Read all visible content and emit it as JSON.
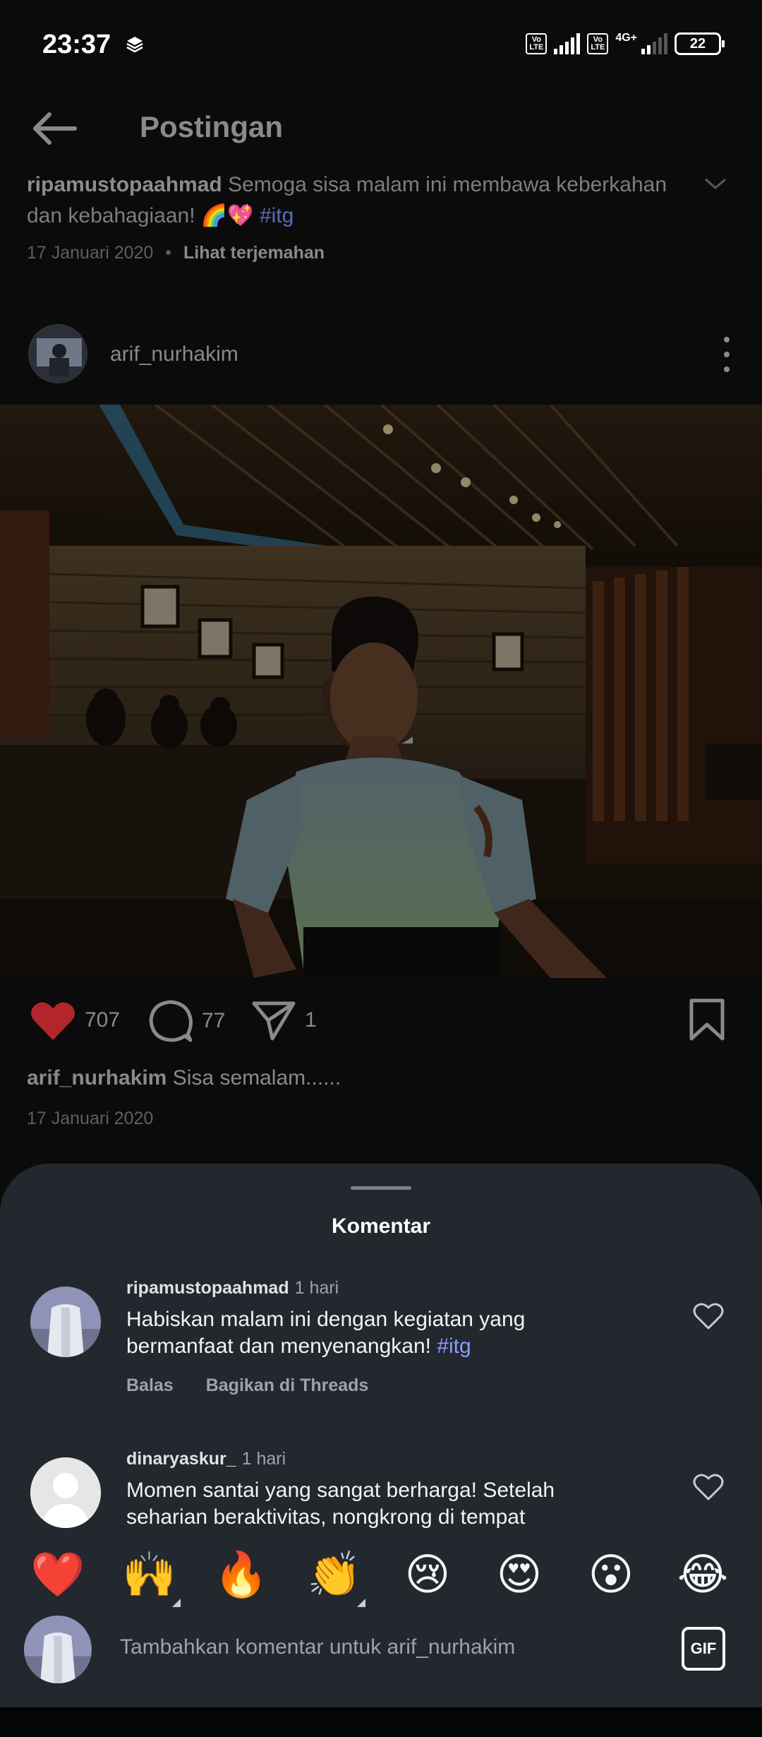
{
  "status": {
    "time": "23:37",
    "battery": "22",
    "network": "4G+",
    "volte": "Vo LTE"
  },
  "header": {
    "title": "Postingan"
  },
  "previous_post": {
    "username": "ripamustopaahmad",
    "caption": "Semoga sisa malam ini membawa keberkahan dan kebahagiaan! 🌈💖",
    "hashtag": "#itg",
    "date": "17 Januari 2020",
    "translate": "Lihat terjemahan"
  },
  "post": {
    "username": "arif_nurhakim",
    "likes": "707",
    "comments": "77",
    "shares": "1",
    "caption": "Sisa semalam......",
    "date": "17 Januari 2020"
  },
  "comments_sheet": {
    "title": "Komentar",
    "items": [
      {
        "username": "ripamustopaahmad",
        "time": "1 hari",
        "text": "Habiskan malam ini dengan kegiatan yang bermanfaat dan menyenangkan!",
        "hashtag": "#itg",
        "reply": "Balas",
        "share": "Bagikan di Threads"
      },
      {
        "username": "dinaryaskur_",
        "time": "1 hari",
        "text": "Momen santai yang sangat berharga! Setelah seharian beraktivitas, nongkrong di tempat nyaman"
      }
    ]
  },
  "emoji_bar": [
    "❤️",
    "🙌",
    "🔥",
    "👏",
    "😢",
    "😍",
    "😮",
    "😂"
  ],
  "composer": {
    "placeholder": "Tambahkan komentar untuk arif_nurhakim",
    "gif_label": "GIF"
  },
  "colors": {
    "like_red": "#c62828",
    "hashtag": "#8c9cff",
    "sheet_bg": "#23272e"
  }
}
